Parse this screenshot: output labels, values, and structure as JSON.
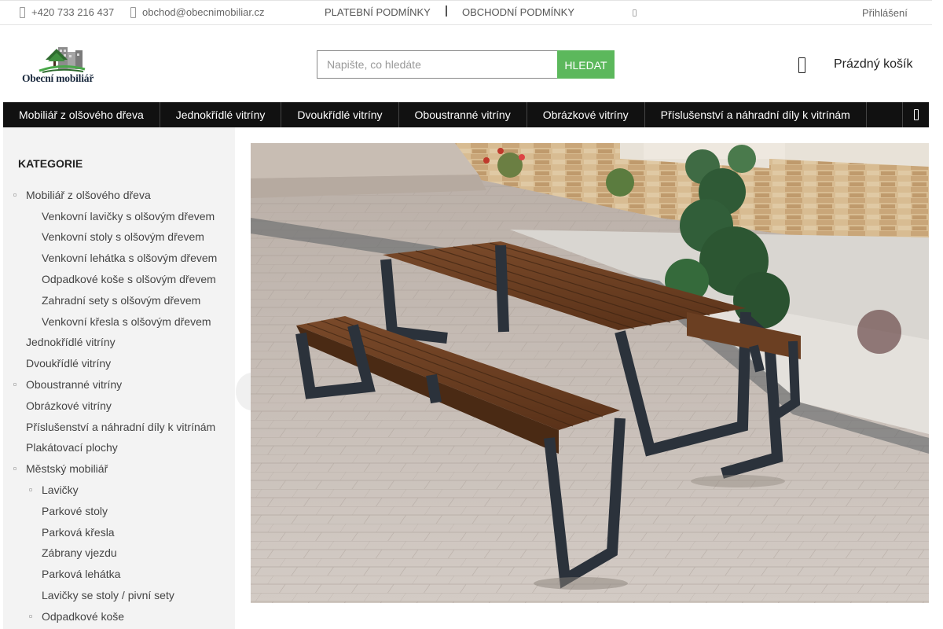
{
  "topbar": {
    "phone": "+420 733 216 437",
    "email": "obchod@obecnimobiliar.cz",
    "payment_terms": "PLATEBNÍ PODMÍNKY",
    "business_terms": "OBCHODNÍ PODMÍNKY",
    "login": "Přihlášení"
  },
  "header": {
    "logo_text": "Obecní mobiliář",
    "search_placeholder": "Napište, co hledáte",
    "search_button": "HLEDAT",
    "cart_label": "Prázdný košík"
  },
  "nav": {
    "items": [
      {
        "label": "Mobiliář z olšového dřeva"
      },
      {
        "label": "Jednokřídlé vitríny"
      },
      {
        "label": "Dvoukřídlé vitríny"
      },
      {
        "label": "Oboustranné vitríny"
      },
      {
        "label": "Obrázkové vitríny"
      },
      {
        "label": "Příslušenství a náhradní díly k vitrínám"
      }
    ]
  },
  "sidebar": {
    "heading": "KATEGORIE",
    "items": [
      {
        "label": "Mobiliář z olšového dřeva",
        "level": 1,
        "bullet": true
      },
      {
        "label": "Venkovní lavičky s olšovým dřevem",
        "level": 2,
        "bullet": false
      },
      {
        "label": "Venkovní stoly s olšovým dřevem",
        "level": 2,
        "bullet": false
      },
      {
        "label": "Venkovní lehátka s olšovým dřevem",
        "level": 2,
        "bullet": false
      },
      {
        "label": "Odpadkové koše s olšovým dřevem",
        "level": 2,
        "bullet": false
      },
      {
        "label": "Zahradní sety s olšovým dřevem",
        "level": 2,
        "bullet": false
      },
      {
        "label": "Venkovní křesla s olšovým dřevem",
        "level": 2,
        "bullet": false
      },
      {
        "label": "Jednokřídlé vitríny",
        "level": 1,
        "bullet": false
      },
      {
        "label": "Dvoukřídlé vitríny",
        "level": 1,
        "bullet": false
      },
      {
        "label": "Oboustranné vitríny",
        "level": 1,
        "bullet": true
      },
      {
        "label": "Obrázkové vitríny",
        "level": 1,
        "bullet": false
      },
      {
        "label": "Příslušenství a náhradní díly k vitrínám",
        "level": 1,
        "bullet": false
      },
      {
        "label": "Plakátovací plochy",
        "level": 1,
        "bullet": false
      },
      {
        "label": "Městský mobiliář",
        "level": 1,
        "bullet": true
      },
      {
        "label": "Lavičky",
        "level": 2,
        "bullet": true
      },
      {
        "label": "Parkové stoly",
        "level": 2,
        "bullet": false
      },
      {
        "label": "Parková křesla",
        "level": 2,
        "bullet": false
      },
      {
        "label": "Zábrany vjezdu",
        "level": 2,
        "bullet": false
      },
      {
        "label": "Parková lehátka",
        "level": 2,
        "bullet": false
      },
      {
        "label": "Lavičky se stoly / pivní sety",
        "level": 2,
        "bullet": false
      },
      {
        "label": "Odpadkové koše",
        "level": 2,
        "bullet": true
      }
    ]
  },
  "colors": {
    "nav_bg": "#111111",
    "search_button": "#5cb85c",
    "sidebar_bg": "#f3f3f3"
  },
  "icons": {
    "phone": "phone-icon",
    "email": "envelope-icon",
    "globe": "globe-icon",
    "cart": "cart-icon",
    "nav_more": "chevron-right-icon"
  }
}
